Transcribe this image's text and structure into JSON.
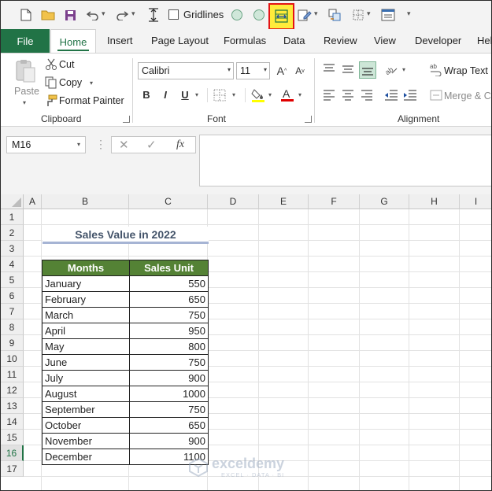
{
  "qat": {
    "gridlines_label": "Gridlines",
    "icons": [
      "new-file-icon",
      "open-folder-icon",
      "save-icon",
      "undo-icon",
      "redo-icon",
      "autofit-height-icon",
      "circle-icon",
      "circle-icon",
      "autofit-column-width-icon",
      "format-cells-icon",
      "compare-icon",
      "borders-icon",
      "form-icon",
      "customize-qat-icon"
    ],
    "highlight_color": "#ffeb3b",
    "highlight_border": "#e31414"
  },
  "tabs": {
    "file": "File",
    "home": "Home",
    "insert": "Insert",
    "page_layout": "Page Layout",
    "formulas": "Formulas",
    "data": "Data",
    "review": "Review",
    "view": "View",
    "developer": "Developer",
    "help": "Help"
  },
  "ribbon": {
    "clipboard": {
      "paste": "Paste",
      "cut": "Cut",
      "copy": "Copy",
      "format_painter": "Format Painter",
      "label": "Clipboard"
    },
    "font": {
      "name": "Calibri",
      "size": "11",
      "bold": "B",
      "italic": "I",
      "underline": "U",
      "label": "Font"
    },
    "alignment": {
      "wrap_text": "Wrap Text",
      "merge": "Merge & Center",
      "label": "Alignment"
    }
  },
  "formula_bar": {
    "name_box": "M16",
    "fx": "fx",
    "value": ""
  },
  "columns": [
    "A",
    "B",
    "C",
    "D",
    "E",
    "F",
    "G",
    "H",
    "I"
  ],
  "rows": [
    "1",
    "2",
    "3",
    "4",
    "5",
    "6",
    "7",
    "8",
    "9",
    "10",
    "11",
    "12",
    "13",
    "14",
    "15",
    "16",
    "17"
  ],
  "active_row": "16",
  "sheet": {
    "title": "Sales Value in 2022",
    "headers": [
      "Months",
      "Sales Unit"
    ],
    "data": [
      {
        "month": "January",
        "value": "550"
      },
      {
        "month": "February",
        "value": "650"
      },
      {
        "month": "March",
        "value": "750"
      },
      {
        "month": "April",
        "value": "950"
      },
      {
        "month": "May",
        "value": "800"
      },
      {
        "month": "June",
        "value": "750"
      },
      {
        "month": "July",
        "value": "900"
      },
      {
        "month": "August",
        "value": "1000"
      },
      {
        "month": "September",
        "value": "750"
      },
      {
        "month": "October",
        "value": "650"
      },
      {
        "month": "November",
        "value": "900"
      },
      {
        "month": "December",
        "value": "1100"
      }
    ],
    "header_fill": "#548235"
  },
  "watermark": {
    "name": "exceldemy",
    "tagline": "EXCEL · DATA · BI"
  }
}
